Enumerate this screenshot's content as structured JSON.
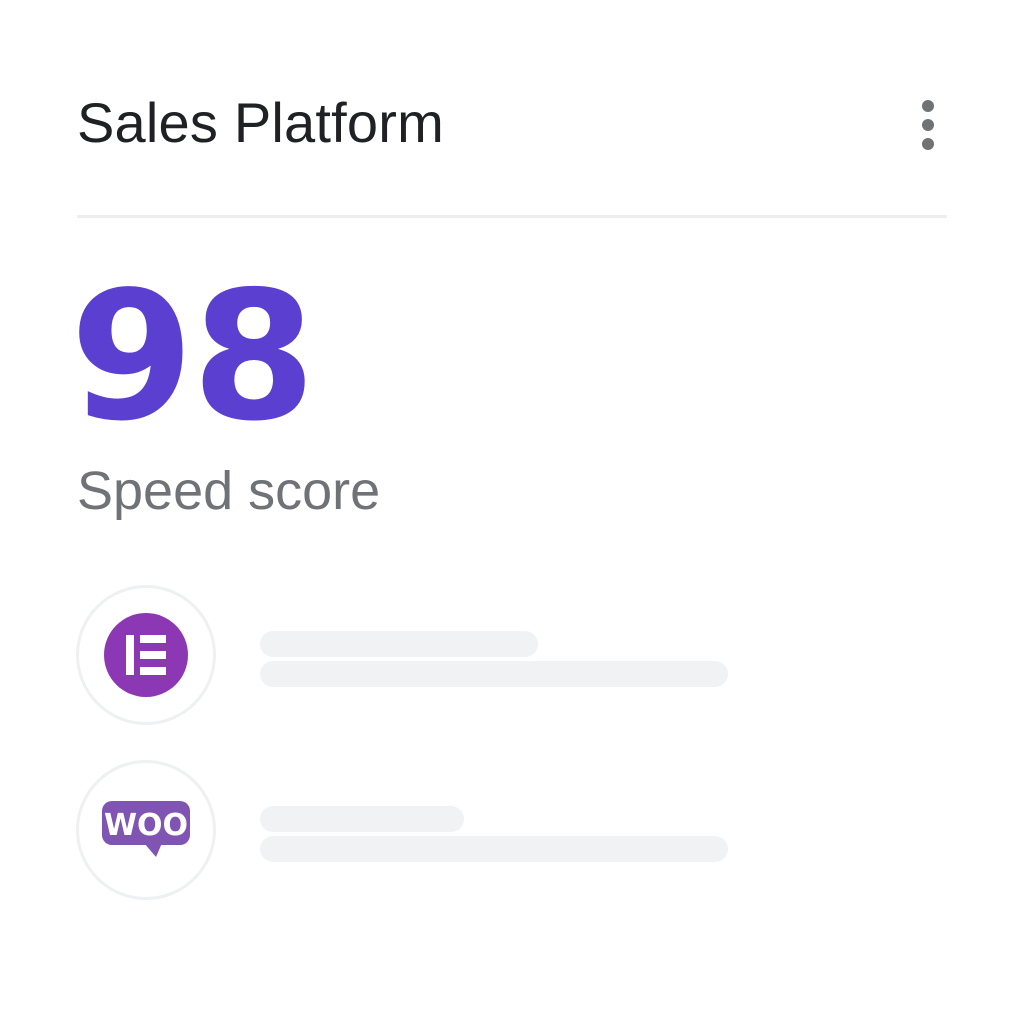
{
  "header": {
    "title": "Sales Platform",
    "menu_icon": "more-vertical-icon"
  },
  "metric": {
    "value": "98",
    "label": "Speed score",
    "accent_color": "#5b3fd1"
  },
  "integrations": [
    {
      "name": "Elementor",
      "icon": "elementor-logo-icon",
      "color": "#92003b"
    },
    {
      "name": "WooCommerce",
      "icon": "woocommerce-logo-icon",
      "color": "#7f54b3",
      "logo_text": "WOO"
    }
  ],
  "colors": {
    "elementor": "#8c38b4",
    "woo": "#7f54b3",
    "skeleton": "#f0f2f4"
  }
}
